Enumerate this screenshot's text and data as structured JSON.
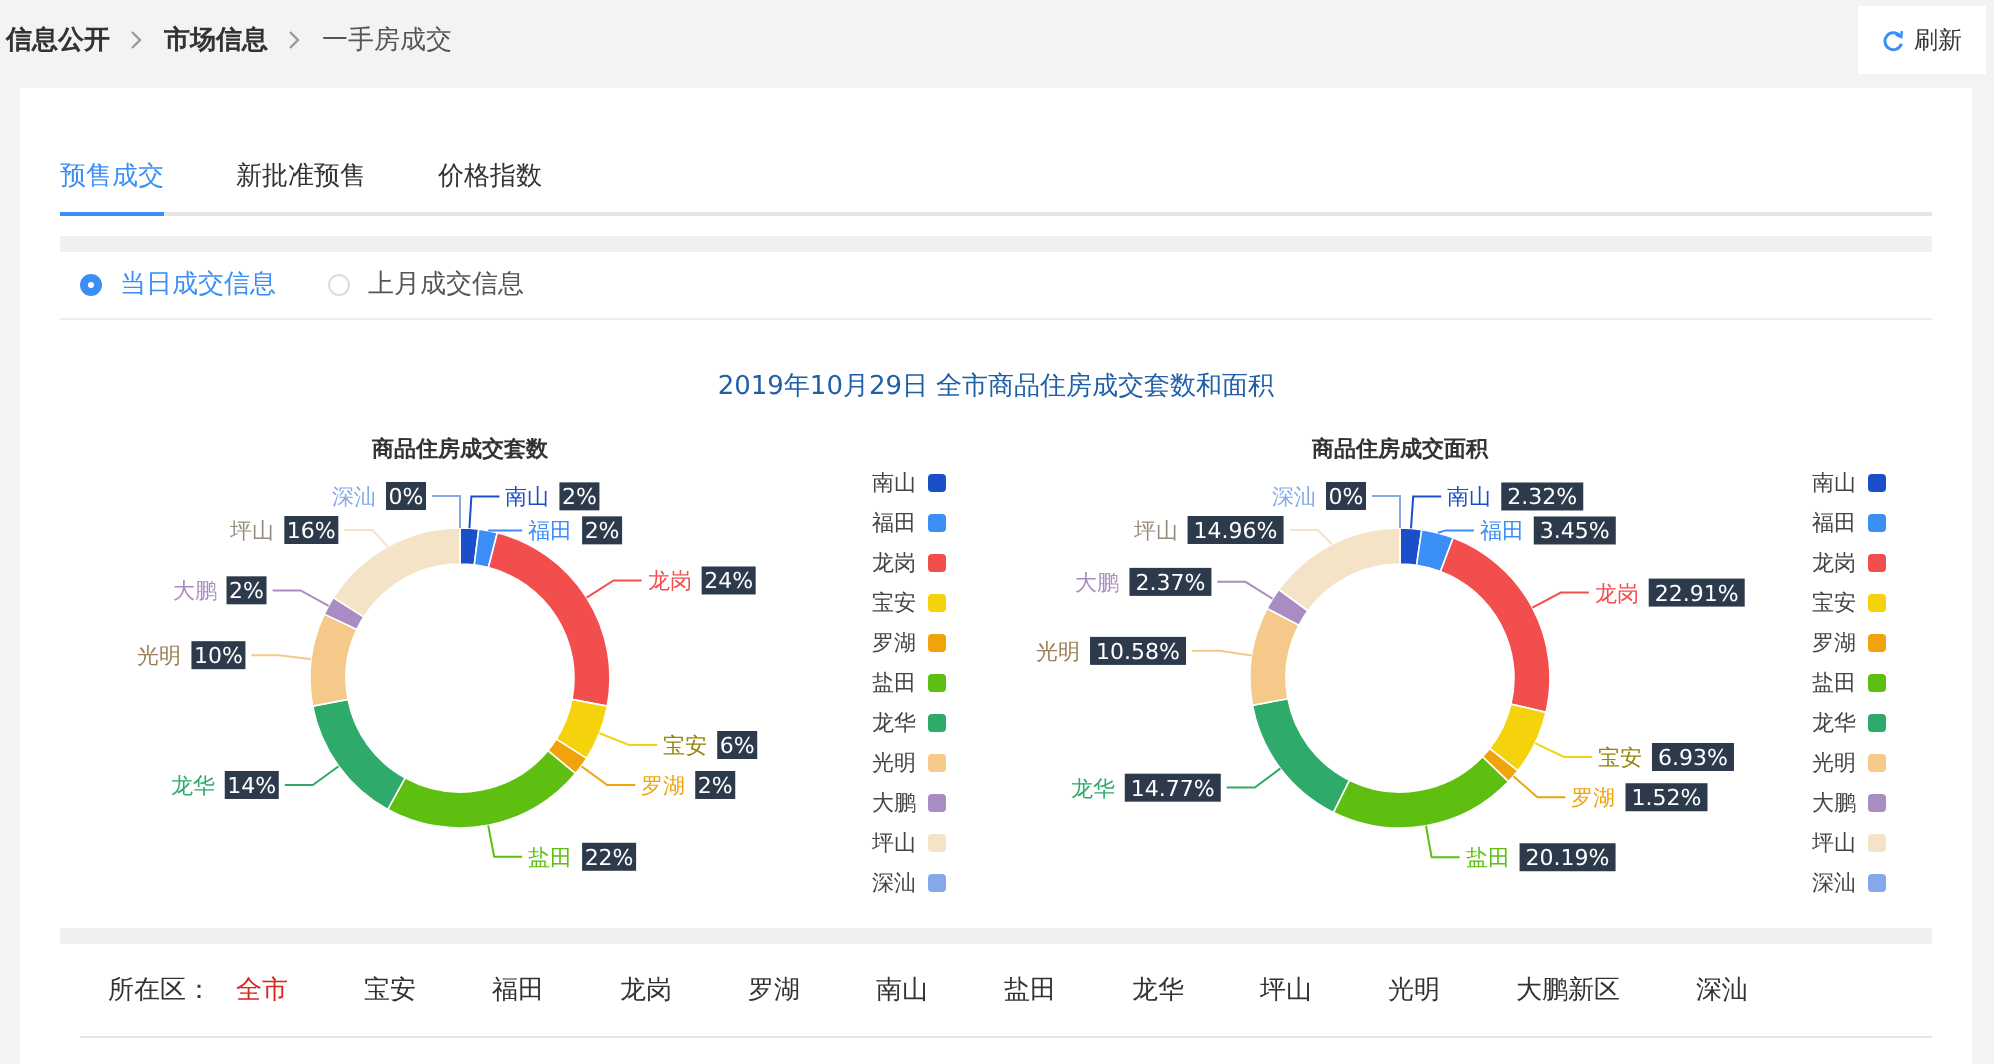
{
  "breadcrumb": [
    {
      "label": "信息公开",
      "current": false
    },
    {
      "label": "市场信息",
      "current": false
    },
    {
      "label": "一手房成交",
      "current": true
    }
  ],
  "refresh_button": {
    "label": "刷新"
  },
  "tabs": [
    {
      "label": "预售成交",
      "selected": true
    },
    {
      "label": "新批准预售",
      "selected": false
    },
    {
      "label": "价格指数",
      "selected": false
    }
  ],
  "radios": [
    {
      "label": "当日成交信息",
      "selected": true
    },
    {
      "label": "上月成交信息",
      "selected": false
    }
  ],
  "heading": "2019年10月29日 全市商品住房成交套数和面积",
  "charts": [
    {
      "legend": [
        {
          "label": "南山",
          "color": "#1a4fc9"
        },
        {
          "label": "福田",
          "color": "#3a8ef6"
        },
        {
          "label": "龙岗",
          "color": "#f24e4e"
        },
        {
          "label": "宝安",
          "color": "#f5d30c"
        },
        {
          "label": "罗湖",
          "color": "#f0a30a"
        },
        {
          "label": "盐田",
          "color": "#5ebf10"
        },
        {
          "label": "龙华",
          "color": "#2eaa6a"
        },
        {
          "label": "光明",
          "color": "#f5c98a"
        },
        {
          "label": "大鹏",
          "color": "#a98cc1"
        },
        {
          "label": "坪山",
          "color": "#f5e3c8"
        },
        {
          "label": "深汕",
          "color": "#85a9e8"
        }
      ],
      "chart_data": {
        "type": "donut",
        "title": "商品住房成交套数",
        "categories": [
          "南山",
          "福田",
          "龙岗",
          "宝安",
          "罗湖",
          "盐田",
          "龙华",
          "光明",
          "大鹏",
          "坪山",
          "深汕"
        ],
        "values": [
          2,
          2,
          24,
          6,
          2,
          22,
          14,
          10,
          2,
          16,
          0
        ],
        "value_labels": [
          "2%",
          "2%",
          "24%",
          "6%",
          "2%",
          "22%",
          "14%",
          "10%",
          "2%",
          "16%",
          "0%"
        ]
      }
    },
    {
      "legend": [
        {
          "label": "南山",
          "color": "#1a4fc9"
        },
        {
          "label": "福田",
          "color": "#3a8ef6"
        },
        {
          "label": "龙岗",
          "color": "#f24e4e"
        },
        {
          "label": "宝安",
          "color": "#f5d30c"
        },
        {
          "label": "罗湖",
          "color": "#f0a30a"
        },
        {
          "label": "盐田",
          "color": "#5ebf10"
        },
        {
          "label": "龙华",
          "color": "#2eaa6a"
        },
        {
          "label": "光明",
          "color": "#f5c98a"
        },
        {
          "label": "大鹏",
          "color": "#a98cc1"
        },
        {
          "label": "坪山",
          "color": "#f5e3c8"
        },
        {
          "label": "深汕",
          "color": "#85a9e8"
        }
      ],
      "chart_data": {
        "type": "donut",
        "title": "商品住房成交面积",
        "categories": [
          "南山",
          "福田",
          "龙岗",
          "宝安",
          "罗湖",
          "盐田",
          "龙华",
          "光明",
          "大鹏",
          "坪山",
          "深汕"
        ],
        "values": [
          2.32,
          3.45,
          22.91,
          6.93,
          1.52,
          20.19,
          14.77,
          10.58,
          2.37,
          14.96,
          0
        ],
        "value_labels": [
          "2.32%",
          "3.45%",
          "22.91%",
          "6.93%",
          "1.52%",
          "20.19%",
          "14.77%",
          "10.58%",
          "2.37%",
          "14.96%",
          "0%"
        ]
      }
    }
  ],
  "district_filter": {
    "label": "所在区：",
    "options": [
      {
        "label": "全市",
        "selected": true
      },
      {
        "label": "宝安",
        "selected": false
      },
      {
        "label": "福田",
        "selected": false
      },
      {
        "label": "龙岗",
        "selected": false
      },
      {
        "label": "罗湖",
        "selected": false
      },
      {
        "label": "南山",
        "selected": false
      },
      {
        "label": "盐田",
        "selected": false
      },
      {
        "label": "龙华",
        "selected": false
      },
      {
        "label": "坪山",
        "selected": false
      },
      {
        "label": "光明",
        "selected": false
      },
      {
        "label": "大鹏新区",
        "selected": false
      },
      {
        "label": "深汕",
        "selected": false
      }
    ]
  }
}
